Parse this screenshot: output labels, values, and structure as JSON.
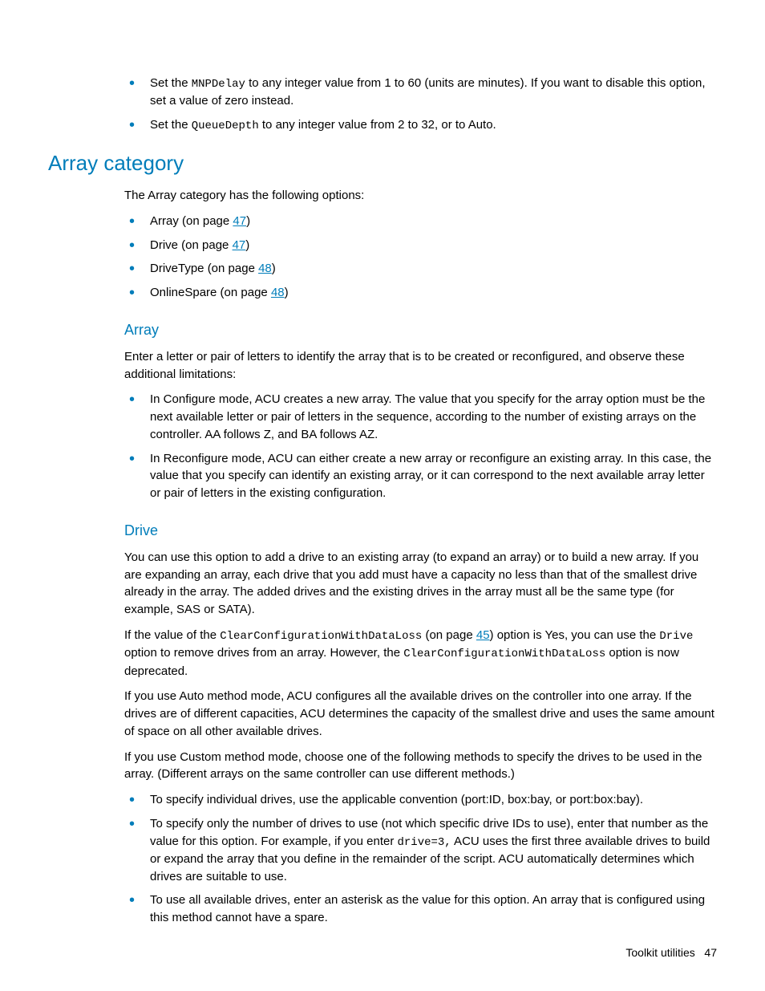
{
  "topBullets": {
    "items": [
      {
        "pre": "Set the ",
        "code": "MNPDelay",
        "post": " to any integer value from 1 to 60 (units are minutes). If you want to disable this option, set a value of zero instead."
      },
      {
        "pre": "Set the ",
        "code": "QueueDepth",
        "post": " to any integer value from 2 to 32, or to Auto."
      }
    ]
  },
  "heading1": "Array category",
  "intro": "The Array category has the following options:",
  "options": [
    {
      "label": "Array (on page ",
      "page": "47",
      "tail": ")"
    },
    {
      "label": "Drive (on page ",
      "page": "47",
      "tail": ")"
    },
    {
      "label": "DriveType (on page ",
      "page": "48",
      "tail": ")"
    },
    {
      "label": "OnlineSpare (on page ",
      "page": "48",
      "tail": ")"
    }
  ],
  "array": {
    "heading": "Array",
    "p1": "Enter a letter or pair of letters to identify the array that is to be created or reconfigured, and observe these additional limitations:",
    "bullets": [
      "In Configure mode, ACU creates a new array. The value that you specify for the array option must be the next available letter or pair of letters in the sequence, according to the number of existing arrays on the controller. AA follows Z, and BA follows AZ.",
      "In Reconfigure mode, ACU can either create a new array or reconfigure an existing array. In this case, the value that you specify can identify an existing array, or it can correspond to the next available array letter or pair of letters in the existing configuration."
    ]
  },
  "drive": {
    "heading": "Drive",
    "p1": "You can use this option to add a drive to an existing array (to expand an array) or to build a new array. If you are expanding an array, each drive that you add must have a capacity no less than that of the smallest drive already in the array. The added drives and the existing drives in the array must all be the same type (for example, SAS or SATA).",
    "p2": {
      "t1": "If the value of the ",
      "c1": "ClearConfigurationWithDataLoss",
      "t2": " (on page ",
      "page": "45",
      "t3": ") option is Yes, you can use the ",
      "c2": "Drive",
      "t4": " option to remove drives from an array. However, the ",
      "c3": "ClearConfigurationWithDataLoss",
      "t5": " option is now deprecated."
    },
    "p3": "If you use Auto method mode, ACU configures all the available drives on the controller into one array. If the drives are of different capacities, ACU determines the capacity of the smallest drive and uses the same amount of space on all other available drives.",
    "p4": "If you use Custom method mode, choose one of the following methods to specify the drives to be used in the array. (Different arrays on the same controller can use different methods.)",
    "bullets": [
      {
        "pre": "To specify individual drives, use the applicable convention (port:ID, box:bay, or port:box:bay).",
        "code": null,
        "post": null
      },
      {
        "pre": "To specify only the number of drives to use (not which specific drive IDs to use), enter that number as the value for this option. For example, if you enter ",
        "code": "drive=3,",
        "post": " ACU uses the first three available drives to build or expand the array that you define in the remainder of the script. ACU automatically determines which drives are suitable to use."
      },
      {
        "pre": "To use all available drives, enter an asterisk as the value for this option. An array that is configured using this method cannot have a spare.",
        "code": null,
        "post": null
      }
    ]
  },
  "footer": {
    "label": "Toolkit utilities",
    "page": "47"
  }
}
